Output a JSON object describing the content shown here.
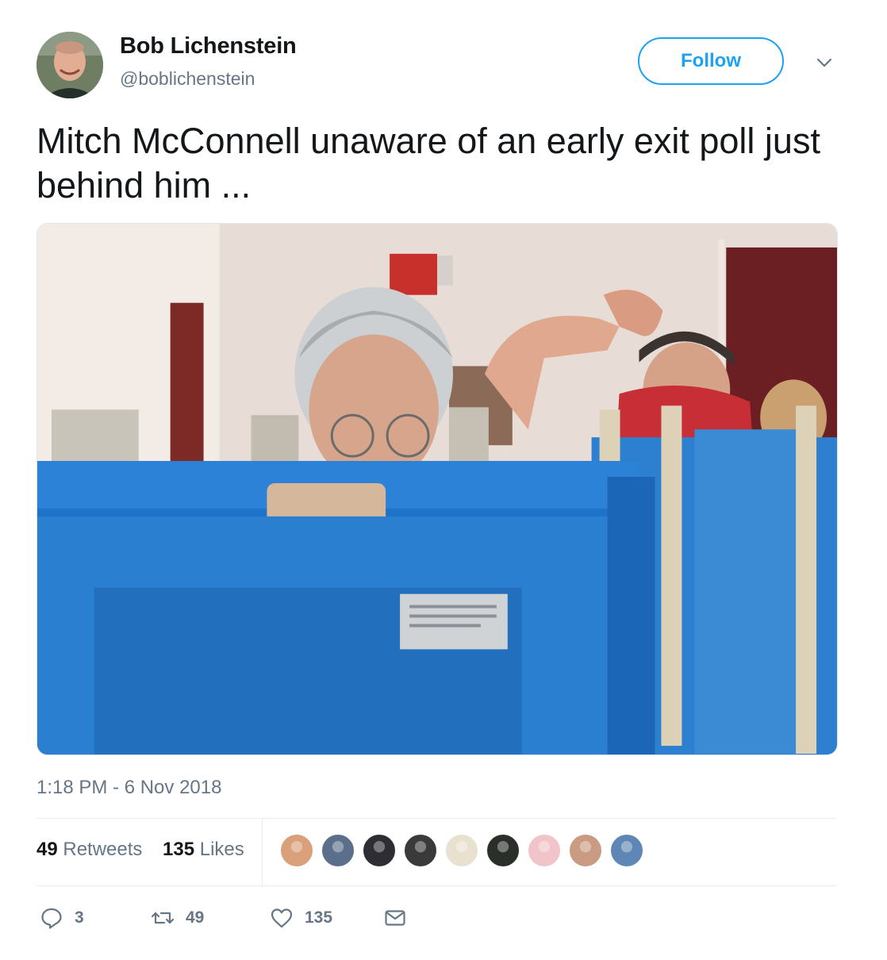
{
  "user": {
    "name": "Bob Lichenstein",
    "handle": "@boblichenstein",
    "follow_label": "Follow"
  },
  "tweet": {
    "text": "Mitch McConnell unaware of an early exit poll just behind him ...",
    "timestamp": "1:18 PM - 6 Nov 2018"
  },
  "stats": {
    "retweets_count": "49",
    "retweets_label": "Retweets",
    "likes_count": "135",
    "likes_label": "Likes"
  },
  "likers": [
    {
      "color": "#d9a07a"
    },
    {
      "color": "#5b6e8c"
    },
    {
      "color": "#2d2d33"
    },
    {
      "color": "#3a3a3a"
    },
    {
      "color": "#e9e1cf"
    },
    {
      "color": "#2b2f2a"
    },
    {
      "color": "#f1c4c9"
    },
    {
      "color": "#c99b82"
    },
    {
      "color": "#5f87b5"
    }
  ],
  "actions": {
    "reply_count": "3",
    "retweet_count": "49",
    "like_count": "135"
  },
  "colors": {
    "accent": "#1da1f2",
    "secondary_text": "#657786",
    "divider": "#e6ecf0",
    "booth_blue": "#2a7fd0"
  },
  "icons": [
    "caret-down-icon",
    "reply-icon",
    "retweet-icon",
    "heart-icon",
    "mail-icon"
  ]
}
